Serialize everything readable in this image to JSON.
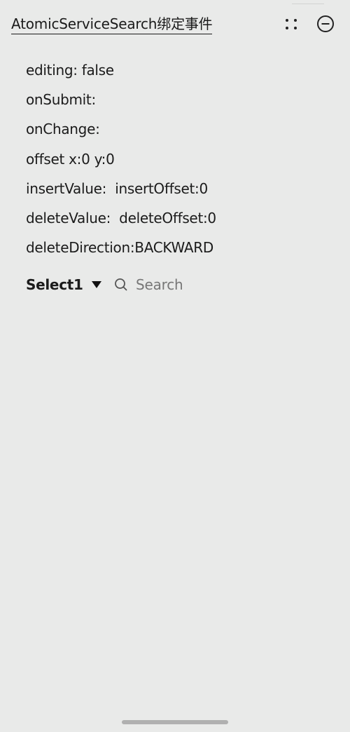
{
  "title_bar": {
    "title": "AtomicServiceSearch绑定事件",
    "more_icon": "four-dots-icon",
    "minimize_icon": "circle-minus-icon"
  },
  "info": {
    "editing": "editing: false",
    "on_submit": "onSubmit:",
    "on_change": "onChange:",
    "offset": "offset x:0 y:0",
    "insert": "insertValue:  insertOffset:0",
    "delete": "deleteValue:  deleteOffset:0",
    "delete_direction": "deleteDirection:BACKWARD"
  },
  "controls": {
    "select_value": "Select1",
    "select_icon": "triangle-down-icon",
    "search_icon": "search-icon",
    "search_placeholder": "Search",
    "search_value": ""
  },
  "colors": {
    "background": "#E9EAE9",
    "text": "#1b1b1b",
    "placeholder": "#777777"
  }
}
